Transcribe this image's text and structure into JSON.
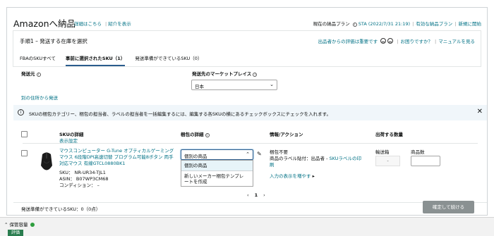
{
  "header": {
    "title": "Amazonへ納品",
    "details_link": "詳細はこちら",
    "intro_link": "紹介を表示",
    "plan_text": "現在の納品プラン",
    "plan_value": "STA (2022/7/31 21:19)",
    "valid_plans": "有効な納品プラン",
    "new_shipment": "新規に開始"
  },
  "step": {
    "title": "手順1 – 発送する在庫を選択",
    "feedback": "出品者からの評価は重要です",
    "help": "お困りですか？",
    "manual": "マニュアルを見る",
    "tabs": [
      {
        "label": "FBAのSKUすべて"
      },
      {
        "label": "事前に選択されたSKU（1）"
      },
      {
        "label": "発送準備ができているSKU（0）"
      }
    ]
  },
  "ship_from": {
    "label": "発送元"
  },
  "marketplace": {
    "label": "発送先のマーケットプレイス",
    "selected": "日本"
  },
  "other_address": "別の住所から発送",
  "alert": {
    "text": "SKUの梱包カテゴリー、梱包の担当者、ラベルの担当者を一括編集するには、編集する各SKUの横にあるチェックボックスにチェックを入れます。"
  },
  "table": {
    "headers": {
      "sku": "SKUの詳細",
      "packing": "梱包の詳細",
      "info": "情報/アクション",
      "qty": "出荷する数量"
    },
    "display_settings": "表示設定",
    "row": {
      "title_line1": "マウスコンピューター G-Tune オプティカルゲーミング",
      "title_line2": "マウス 6段階DPI高速切替 プログラム可能8ボタン 両手",
      "title_line3": "対応マウス 有線GTCL0880BK1",
      "sku": "SKU：  NR-UR34-TJL1",
      "asin": "ASIN：  B07WP3CM68",
      "condition": "コンディション：  –",
      "packing_selected": "個別の商品",
      "dropdown": {
        "option1": "個別の商品",
        "option2_line1": "新しいメーカー梱包テンプレ",
        "option2_line2": "ートを作成"
      },
      "info_prep": "梱包不要",
      "info_label": "商品のラベル貼付：出品者 - ",
      "info_label_link": "SKUラベルの印",
      "info_label_link2": "刷",
      "more_inputs": "入力の表示を増やす",
      "boxes_label": "輸送箱",
      "boxes_value": "-",
      "units_label": "商品数"
    }
  },
  "pager": {
    "prev": "‹",
    "page": "1",
    "next": "›"
  },
  "footer": {
    "ready_text": "発送準備ができているSKU：0（0点）",
    "confirm_button": "確定して続ける"
  },
  "statusbar": {
    "label": "保管容量",
    "tab": "評価"
  }
}
